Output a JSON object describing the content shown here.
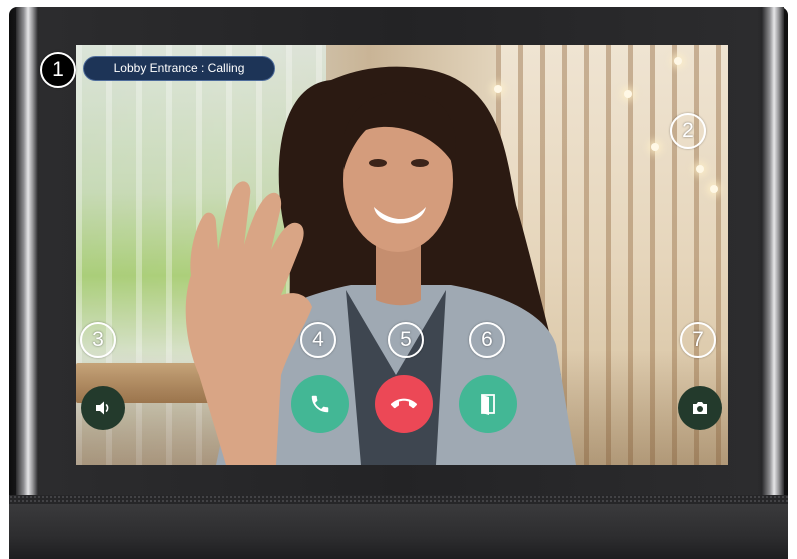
{
  "call": {
    "status_label": "Lobby Entrance : Calling"
  },
  "callouts": [
    "1",
    "2",
    "3",
    "4",
    "5",
    "6",
    "7"
  ],
  "controls": {
    "speaker_icon": "speaker-icon",
    "answer_icon": "phone-icon",
    "hangup_icon": "phone-hangup-icon",
    "door_icon": "door-open-icon",
    "snapshot_icon": "camera-icon"
  },
  "colors": {
    "status_pill": "#1d3457",
    "answer": "#43b795",
    "hangup": "#ec4856",
    "door": "#43b795",
    "small_buttons": "#233a2c",
    "bezel": "#232325"
  }
}
